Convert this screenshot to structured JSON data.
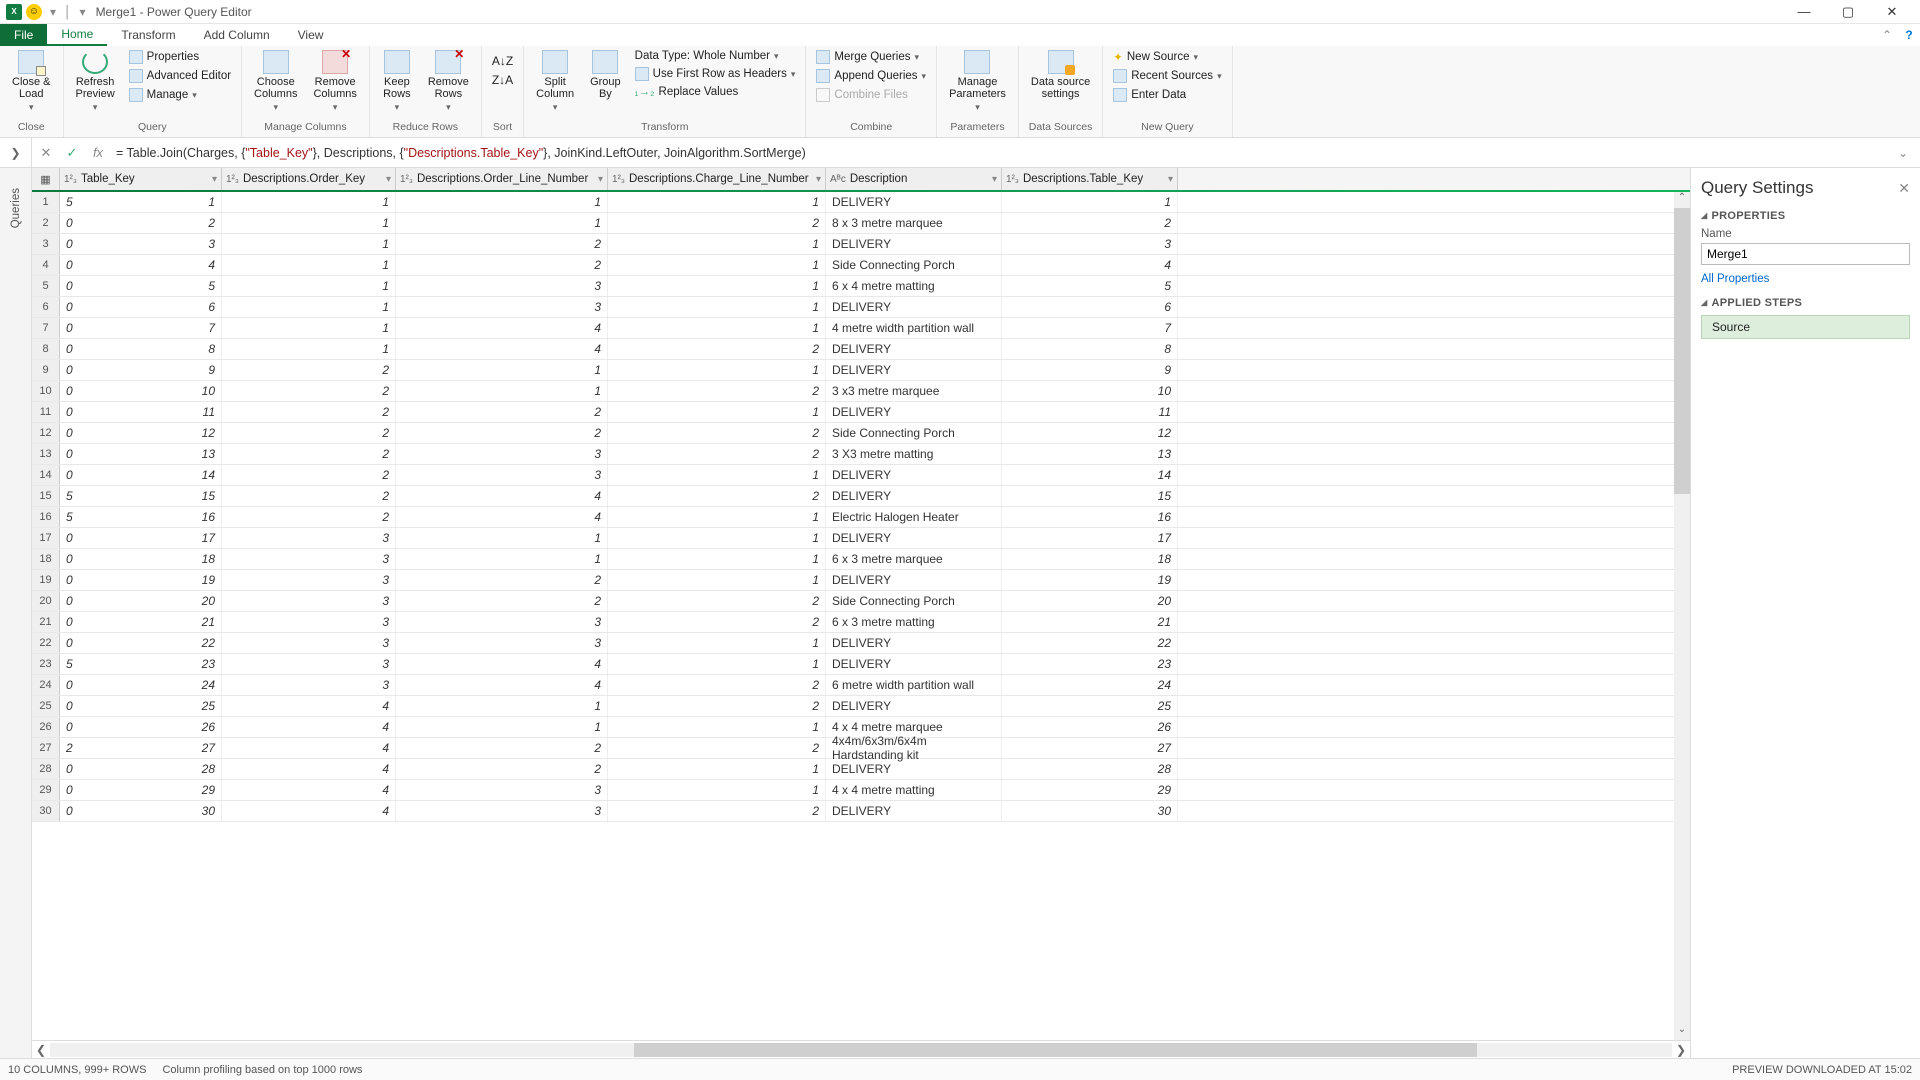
{
  "titlebar": {
    "title": "Merge1 - Power Query Editor"
  },
  "tabs": {
    "file": "File",
    "home": "Home",
    "transform": "Transform",
    "addcolumn": "Add Column",
    "view": "View"
  },
  "ribbon": {
    "close": {
      "closeLoad": "Close &\nLoad",
      "group": "Close"
    },
    "query": {
      "refresh": "Refresh\nPreview",
      "properties": "Properties",
      "advEditor": "Advanced Editor",
      "manage": "Manage",
      "group": "Query"
    },
    "mcols": {
      "choose": "Choose\nColumns",
      "remove": "Remove\nColumns",
      "group": "Manage Columns"
    },
    "rrows": {
      "keep": "Keep\nRows",
      "remove": "Remove\nRows",
      "group": "Reduce Rows"
    },
    "sort": {
      "group": "Sort"
    },
    "transform": {
      "split": "Split\nColumn",
      "groupby": "Group\nBy",
      "dtype": "Data Type: Whole Number",
      "firstrow": "Use First Row as Headers",
      "replace": "Replace Values",
      "group": "Transform"
    },
    "combine": {
      "merge": "Merge Queries",
      "append": "Append Queries",
      "combineFiles": "Combine Files",
      "group": "Combine"
    },
    "params": {
      "btn": "Manage\nParameters",
      "group": "Parameters"
    },
    "dsrc": {
      "btn": "Data source\nsettings",
      "group": "Data Sources"
    },
    "newq": {
      "newSource": "New Source",
      "recent": "Recent Sources",
      "enter": "Enter Data",
      "group": "New Query"
    }
  },
  "formula": {
    "pre": "= Table.Join(Charges, {",
    "s1": "\"Table_Key\"",
    "mid1": "}, Descriptions, {",
    "s2": "\"Descriptions.Table_Key\"",
    "post": "}, JoinKind.LeftOuter, JoinAlgorithm.SortMerge)"
  },
  "leftTab": "Queries",
  "columns": [
    {
      "type": "1²₃",
      "name": "Table_Key"
    },
    {
      "type": "1²₃",
      "name": "Descriptions.Order_Key"
    },
    {
      "type": "1²₃",
      "name": "Descriptions.Order_Line_Number"
    },
    {
      "type": "1²₃",
      "name": "Descriptions.Charge_Line_Number"
    },
    {
      "type": "Aᴮc",
      "name": "Description"
    },
    {
      "type": "1²₃",
      "name": "Descriptions.Table_Key"
    }
  ],
  "rows": [
    {
      "n": 1,
      "a": "5",
      "tk": 1,
      "ok": 1,
      "ol": 1,
      "cl": 1,
      "desc": "DELIVERY",
      "dtk": 1
    },
    {
      "n": 2,
      "a": "0",
      "tk": 2,
      "ok": 1,
      "ol": 1,
      "cl": 2,
      "desc": "8 x 3 metre marquee",
      "dtk": 2
    },
    {
      "n": 3,
      "a": "0",
      "tk": 3,
      "ok": 1,
      "ol": 2,
      "cl": 1,
      "desc": "DELIVERY",
      "dtk": 3
    },
    {
      "n": 4,
      "a": "0",
      "tk": 4,
      "ok": 1,
      "ol": 2,
      "cl": 1,
      "desc": "Side Connecting Porch",
      "dtk": 4
    },
    {
      "n": 5,
      "a": "0",
      "tk": 5,
      "ok": 1,
      "ol": 3,
      "cl": 1,
      "desc": "6 x 4 metre matting",
      "dtk": 5
    },
    {
      "n": 6,
      "a": "0",
      "tk": 6,
      "ok": 1,
      "ol": 3,
      "cl": 1,
      "desc": "DELIVERY",
      "dtk": 6
    },
    {
      "n": 7,
      "a": "0",
      "tk": 7,
      "ok": 1,
      "ol": 4,
      "cl": 1,
      "desc": "4 metre width partition wall",
      "dtk": 7
    },
    {
      "n": 8,
      "a": "0",
      "tk": 8,
      "ok": 1,
      "ol": 4,
      "cl": 2,
      "desc": "DELIVERY",
      "dtk": 8
    },
    {
      "n": 9,
      "a": "0",
      "tk": 9,
      "ok": 2,
      "ol": 1,
      "cl": 1,
      "desc": "DELIVERY",
      "dtk": 9
    },
    {
      "n": 10,
      "a": "0",
      "tk": 10,
      "ok": 2,
      "ol": 1,
      "cl": 2,
      "desc": "3 x3 metre marquee",
      "dtk": 10
    },
    {
      "n": 11,
      "a": "0",
      "tk": 11,
      "ok": 2,
      "ol": 2,
      "cl": 1,
      "desc": "DELIVERY",
      "dtk": 11
    },
    {
      "n": 12,
      "a": "0",
      "tk": 12,
      "ok": 2,
      "ol": 2,
      "cl": 2,
      "desc": "Side Connecting Porch",
      "dtk": 12
    },
    {
      "n": 13,
      "a": "0",
      "tk": 13,
      "ok": 2,
      "ol": 3,
      "cl": 2,
      "desc": "3 X3 metre matting",
      "dtk": 13
    },
    {
      "n": 14,
      "a": "0",
      "tk": 14,
      "ok": 2,
      "ol": 3,
      "cl": 1,
      "desc": "DELIVERY",
      "dtk": 14
    },
    {
      "n": 15,
      "a": "5",
      "tk": 15,
      "ok": 2,
      "ol": 4,
      "cl": 2,
      "desc": "DELIVERY",
      "dtk": 15
    },
    {
      "n": 16,
      "a": "5",
      "tk": 16,
      "ok": 2,
      "ol": 4,
      "cl": 1,
      "desc": "Electric Halogen Heater",
      "dtk": 16
    },
    {
      "n": 17,
      "a": "0",
      "tk": 17,
      "ok": 3,
      "ol": 1,
      "cl": 1,
      "desc": "DELIVERY",
      "dtk": 17
    },
    {
      "n": 18,
      "a": "0",
      "tk": 18,
      "ok": 3,
      "ol": 1,
      "cl": 1,
      "desc": "6 x 3 metre marquee",
      "dtk": 18
    },
    {
      "n": 19,
      "a": "0",
      "tk": 19,
      "ok": 3,
      "ol": 2,
      "cl": 1,
      "desc": "DELIVERY",
      "dtk": 19
    },
    {
      "n": 20,
      "a": "0",
      "tk": 20,
      "ok": 3,
      "ol": 2,
      "cl": 2,
      "desc": "Side Connecting Porch",
      "dtk": 20
    },
    {
      "n": 21,
      "a": "0",
      "tk": 21,
      "ok": 3,
      "ol": 3,
      "cl": 2,
      "desc": "6 x 3 metre matting",
      "dtk": 21
    },
    {
      "n": 22,
      "a": "0",
      "tk": 22,
      "ok": 3,
      "ol": 3,
      "cl": 1,
      "desc": "DELIVERY",
      "dtk": 22
    },
    {
      "n": 23,
      "a": "5",
      "tk": 23,
      "ok": 3,
      "ol": 4,
      "cl": 1,
      "desc": "DELIVERY",
      "dtk": 23
    },
    {
      "n": 24,
      "a": "0",
      "tk": 24,
      "ok": 3,
      "ol": 4,
      "cl": 2,
      "desc": "6 metre width partition wall",
      "dtk": 24
    },
    {
      "n": 25,
      "a": "0",
      "tk": 25,
      "ok": 4,
      "ol": 1,
      "cl": 2,
      "desc": "DELIVERY",
      "dtk": 25
    },
    {
      "n": 26,
      "a": "0",
      "tk": 26,
      "ok": 4,
      "ol": 1,
      "cl": 1,
      "desc": "4 x 4 metre marquee",
      "dtk": 26
    },
    {
      "n": 27,
      "a": "2",
      "tk": 27,
      "ok": 4,
      "ol": 2,
      "cl": 2,
      "desc": "4x4m/6x3m/6x4m Hardstanding kit",
      "dtk": 27
    },
    {
      "n": 28,
      "a": "0",
      "tk": 28,
      "ok": 4,
      "ol": 2,
      "cl": 1,
      "desc": "DELIVERY",
      "dtk": 28
    },
    {
      "n": 29,
      "a": "0",
      "tk": 29,
      "ok": 4,
      "ol": 3,
      "cl": 1,
      "desc": "4 x 4 metre matting",
      "dtk": 29
    },
    {
      "n": 30,
      "a": "0",
      "tk": 30,
      "ok": 4,
      "ol": 3,
      "cl": 2,
      "desc": "DELIVERY",
      "dtk": 30
    }
  ],
  "qsettings": {
    "title": "Query Settings",
    "properties": "PROPERTIES",
    "nameLabel": "Name",
    "nameValue": "Merge1",
    "allProps": "All Properties",
    "steps": "APPLIED STEPS",
    "step1": "Source"
  },
  "status": {
    "left1": "10 COLUMNS, 999+ ROWS",
    "left2": "Column profiling based on top 1000 rows",
    "right": "PREVIEW DOWNLOADED AT 15:02"
  }
}
